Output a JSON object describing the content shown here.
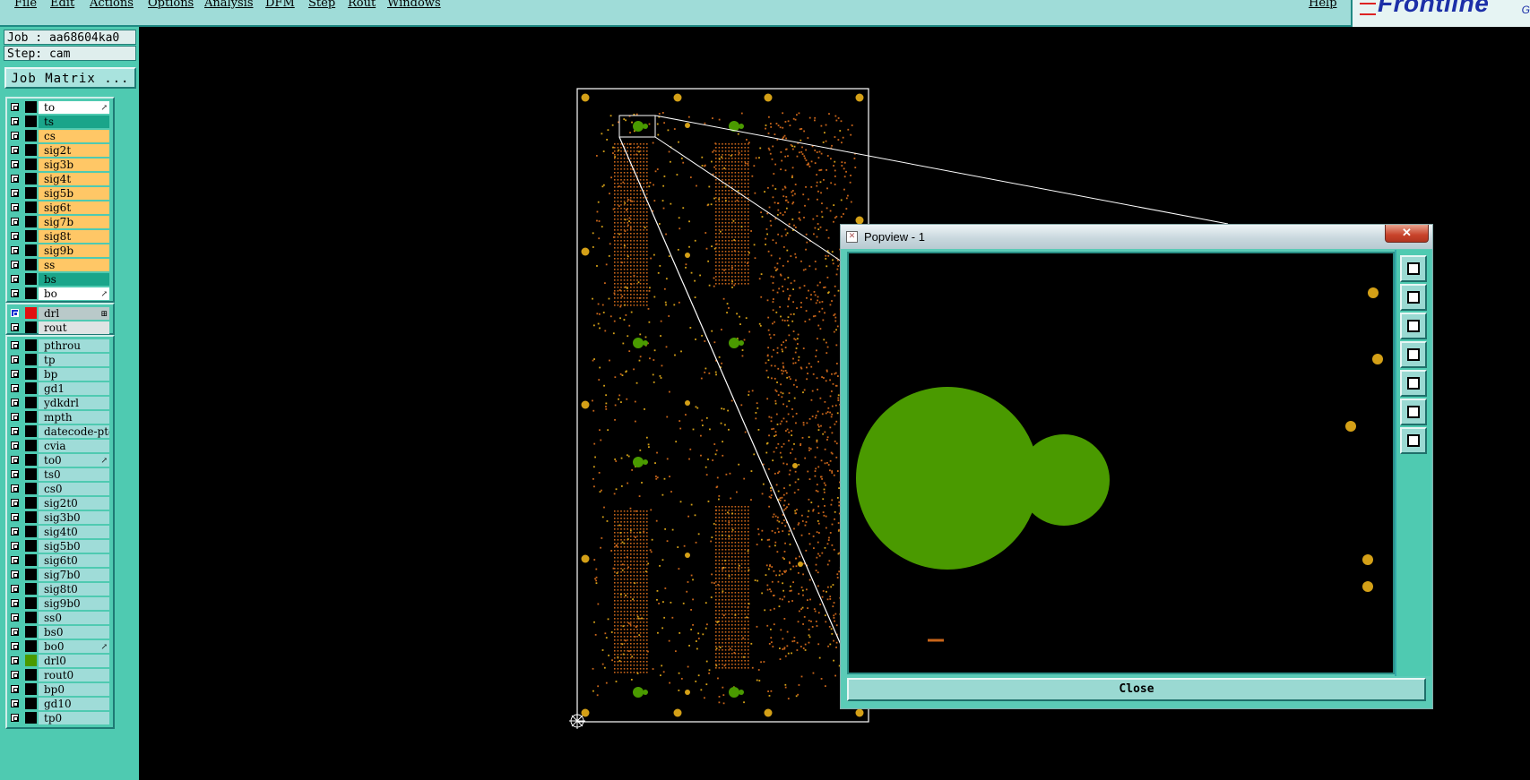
{
  "menu": [
    "File",
    "Edit",
    "Actions",
    "Options",
    "Analysis",
    "DFM",
    "Step",
    "Rout",
    "Windows"
  ],
  "help_label": "Help",
  "logo_text": "Frontline",
  "logo_suffix": "G",
  "job_label": "Job : aa68604ka0",
  "step_label": "Step: cam",
  "job_matrix_label": "Job Matrix ...",
  "layer_groups": [
    [
      {
        "name": "to",
        "color": "#ffffff",
        "mark": "↗"
      },
      {
        "name": "ts",
        "color": "#1aa58a"
      },
      {
        "name": "cs",
        "color": "#ffc766"
      },
      {
        "name": "sig2t",
        "color": "#ffc766"
      },
      {
        "name": "sig3b",
        "color": "#ffc766"
      },
      {
        "name": "sig4t",
        "color": "#ffc766"
      },
      {
        "name": "sig5b",
        "color": "#ffc766"
      },
      {
        "name": "sig6t",
        "color": "#ffc766"
      },
      {
        "name": "sig7b",
        "color": "#ffc766"
      },
      {
        "name": "sig8t",
        "color": "#ffc766"
      },
      {
        "name": "sig9b",
        "color": "#ffc766"
      },
      {
        "name": "ss",
        "color": "#ffc766"
      },
      {
        "name": "bs",
        "color": "#1aa58a"
      },
      {
        "name": "bo",
        "color": "#ffffff",
        "mark": "↗"
      }
    ],
    [
      {
        "name": "drl",
        "color": "#b9c9c9",
        "swatch": "#e01010",
        "selected": true,
        "mark": "⊞"
      },
      {
        "name": "rout",
        "color": "#dfe4e4"
      }
    ],
    [
      {
        "name": "pthrou",
        "color": "#9fdcd8"
      },
      {
        "name": "tp",
        "color": "#9fdcd8"
      },
      {
        "name": "bp",
        "color": "#9fdcd8"
      },
      {
        "name": "gd1",
        "color": "#9fdcd8"
      },
      {
        "name": "ydkdrl",
        "color": "#9fdcd8"
      },
      {
        "name": "mpth",
        "color": "#9fdcd8"
      },
      {
        "name": "datecode-pto",
        "color": "#9fdcd8"
      },
      {
        "name": "cvia",
        "color": "#9fdcd8"
      },
      {
        "name": "to0",
        "color": "#9fdcd8",
        "mark": "↗"
      },
      {
        "name": "ts0",
        "color": "#9fdcd8"
      },
      {
        "name": "cs0",
        "color": "#9fdcd8"
      },
      {
        "name": "sig2t0",
        "color": "#9fdcd8"
      },
      {
        "name": "sig3b0",
        "color": "#9fdcd8"
      },
      {
        "name": "sig4t0",
        "color": "#9fdcd8"
      },
      {
        "name": "sig5b0",
        "color": "#9fdcd8"
      },
      {
        "name": "sig6t0",
        "color": "#9fdcd8"
      },
      {
        "name": "sig7b0",
        "color": "#9fdcd8"
      },
      {
        "name": "sig8t0",
        "color": "#9fdcd8"
      },
      {
        "name": "sig9b0",
        "color": "#9fdcd8"
      },
      {
        "name": "ss0",
        "color": "#9fdcd8"
      },
      {
        "name": "bs0",
        "color": "#9fdcd8"
      },
      {
        "name": "bo0",
        "color": "#9fdcd8",
        "mark": "↗"
      },
      {
        "name": "drl0",
        "color": "#9fdcd8",
        "swatch": "#4a9a00"
      },
      {
        "name": "rout0",
        "color": "#9fdcd8"
      },
      {
        "name": "bp0",
        "color": "#9fdcd8"
      },
      {
        "name": "gd10",
        "color": "#9fdcd8"
      },
      {
        "name": "tp0",
        "color": "#9fdcd8"
      }
    ]
  ],
  "popview": {
    "title": "Popview - 1",
    "close_x": "✕",
    "close_label": "Close",
    "tools": [
      "zoom-fit-icon",
      "pan-up-icon",
      "pan-down-icon",
      "pan-left-icon",
      "pan-right-icon",
      "zoom-out-icon",
      "zoom-in-icon"
    ]
  },
  "colors": {
    "pad": "#d4a017",
    "drill_green": "#4a9a00",
    "trace_orange": "#c8651a",
    "board_outline": "#ffffff",
    "background": "#000000",
    "panel": "#4fcab1"
  }
}
